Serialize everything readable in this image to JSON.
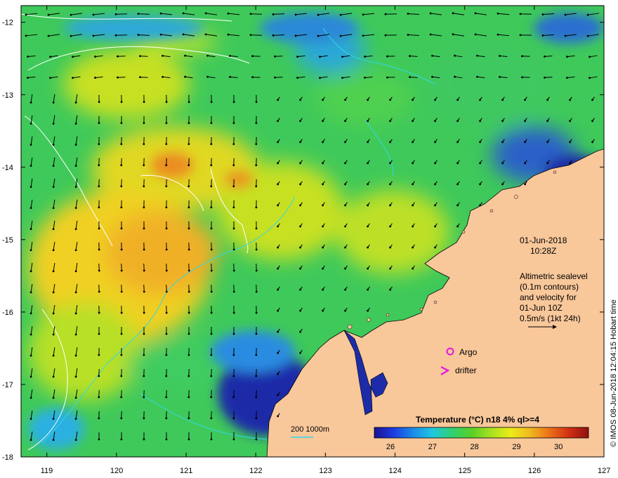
{
  "map": {
    "lat_labels": [
      "-12",
      "-13",
      "-14",
      "-15",
      "-16",
      "-17",
      "-18"
    ],
    "lon_labels": [
      "119",
      "120",
      "121",
      "122",
      "123",
      "124",
      "125",
      "126",
      "127"
    ],
    "colors": {
      "land": "#f8c79a",
      "deep_water": "#1a1ca8",
      "cold": "#2a78d8",
      "cool": "#29b8e8",
      "mid": "#39c95a",
      "warm_green": "#7ad628",
      "yellow": "#e8e81c",
      "warm": "#f0a820",
      "hot": "#e04a18",
      "contour_white": "#ffffff",
      "contour_cyan": "#30d8e8",
      "argo": "#e018e0",
      "drifter": "#e018e0"
    }
  },
  "annotations": {
    "date": "01-Jun-2018",
    "time": "10:28Z",
    "altimetry_lines": [
      "Altimetric sealevel",
      "(0.1m contours)",
      "and velocity for",
      "01-Jun 10Z",
      "0.5m/s (1kt 24h)"
    ],
    "argo_label": "Argo",
    "drifter_label": "drifter",
    "bathymetry_label": "200  1000m",
    "credit": "© IMOS 08-Jun-2018 12:04:15 Hobart time"
  },
  "colorbar": {
    "title": "Temperature (°C) n18 4% ql>=4",
    "ticks": [
      "26",
      "27",
      "28",
      "29",
      "30"
    ],
    "stops": [
      "#1a1290",
      "#1c3ce0",
      "#1c8ce8",
      "#20c8e0",
      "#30d070",
      "#58d028",
      "#a8e020",
      "#ecec18",
      "#f0b820",
      "#ec7018",
      "#d03014",
      "#901010"
    ]
  }
}
